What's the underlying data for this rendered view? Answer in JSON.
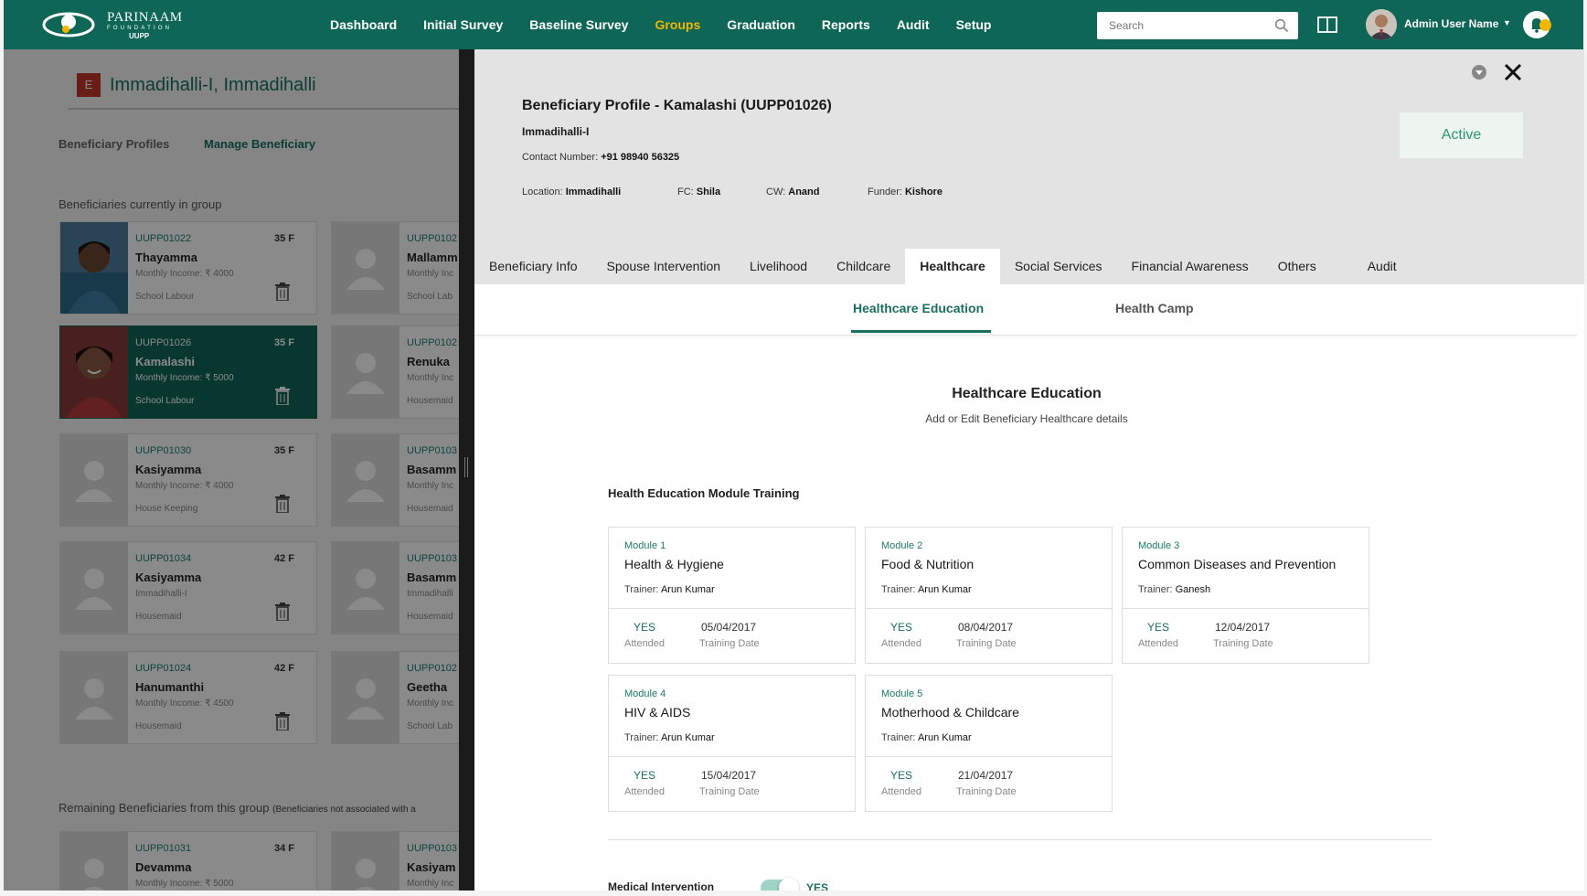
{
  "topbar": {
    "brand_main": "PARINAAM",
    "brand_sub": "FOUNDATION",
    "brand_tag": "UUPP",
    "nav": [
      "Dashboard",
      "Initial Survey",
      "Baseline Survey",
      "Groups",
      "Graduation",
      "Reports",
      "Audit",
      "Setup"
    ],
    "active_nav": "Groups",
    "search_placeholder": "Search",
    "user_name": "Admin User Name",
    "accent_color": "#0d6656",
    "highlight_color": "#f2b705"
  },
  "group": {
    "badge": "E",
    "title": "Immadihalli-I, Immadihalli",
    "tabs": [
      "Beneficiary Profiles",
      "Manage Beneficiary"
    ],
    "current_label": "Beneficiaries currently in group",
    "remaining_label": "Remaining Beneficiaries from this group",
    "remaining_note": "(Beneficiaries not associated with a",
    "current": [
      {
        "id": "UUPP01022",
        "age": "35 F",
        "name": "Thayamma",
        "income": "Monthly Income: ₹ 4000",
        "occupation": "School Labour"
      },
      {
        "id": "UUPP0102",
        "age": "",
        "name": "Mallamm",
        "income": "Monthly Inc",
        "occupation": "School Lab"
      },
      {
        "id": "UUPP01026",
        "age": "35 F",
        "name": "Kamalashi",
        "income": "Monthly Income: ₹ 5000",
        "occupation": "School Labour"
      },
      {
        "id": "UUPP0102",
        "age": "",
        "name": "Renuka",
        "income": "Monthly Inc",
        "occupation": "Housemaid"
      },
      {
        "id": "UUPP01030",
        "age": "35 F",
        "name": "Kasiyamma",
        "income": "Monthly Income: ₹ 4000",
        "occupation": "House Keeping"
      },
      {
        "id": "UUPP0103",
        "age": "",
        "name": "Basamm",
        "income": "Monthly Inc",
        "occupation": "Housemaid"
      },
      {
        "id": "UUPP01034",
        "age": "42 F",
        "name": "Kasiyamma",
        "income": "Immadihalli-I",
        "occupation": "Housemaid"
      },
      {
        "id": "UUPP0103",
        "age": "",
        "name": "Basamm",
        "income": "Immadihalli",
        "occupation": "Housemaid"
      },
      {
        "id": "UUPP01024",
        "age": "42 F",
        "name": "Hanumanthi",
        "income": "Monthly Income: ₹ 4500",
        "occupation": "Housemaid"
      },
      {
        "id": "UUPP0102",
        "age": "",
        "name": "Geetha",
        "income": "Monthly Inc",
        "occupation": "School Lab"
      }
    ],
    "remaining": [
      {
        "id": "UUPP01031",
        "age": "34 F",
        "name": "Devamma",
        "income": "Monthly Income: ₹ 5000",
        "occupation": ""
      },
      {
        "id": "UUPP0103",
        "age": "",
        "name": "Kasiyam",
        "income": "Monthly Inc",
        "occupation": ""
      }
    ]
  },
  "profile": {
    "title": "Beneficiary Profile - Kamalashi (UUPP01026)",
    "group": "Immadihalli-I",
    "contact_label": "Contact Number:",
    "contact": "+91 98940 56325",
    "location_label": "Location:",
    "location": "Immadihalli",
    "fc_label": "FC:",
    "fc": "Shila",
    "cw_label": "CW:",
    "cw": "Anand",
    "funder_label": "Funder:",
    "funder": "Kishore",
    "status": "Active",
    "tabs": [
      "Beneficiary Info",
      "Spouse Intervention",
      "Livelihood",
      "Childcare",
      "Healthcare",
      "Social Services",
      "Financial Awareness",
      "Others",
      "Audit"
    ],
    "active_tab": "Healthcare",
    "subtabs": [
      "Healthcare Education",
      "Health Camp"
    ],
    "active_subtab": "Healthcare Education"
  },
  "healthcare": {
    "title": "Healthcare Education",
    "description": "Add or Edit Beneficiary Healthcare details",
    "modules_heading": "Health Education Module Training",
    "trainer_label": "Trainer:",
    "attended_label": "Attended",
    "date_label": "Training Date",
    "modules": [
      {
        "num": "Module 1",
        "name": "Health & Hygiene",
        "trainer": "Arun Kumar",
        "attended": "YES",
        "date": "05/04/2017"
      },
      {
        "num": "Module 2",
        "name": "Food & Nutrition",
        "trainer": "Arun Kumar",
        "attended": "YES",
        "date": "08/04/2017"
      },
      {
        "num": "Module 3",
        "name": "Common Diseases and Prevention",
        "trainer": "Ganesh",
        "attended": "YES",
        "date": "12/04/2017"
      },
      {
        "num": "Module 4",
        "name": "HIV & AIDS",
        "trainer": "Arun Kumar",
        "attended": "YES",
        "date": "15/04/2017"
      },
      {
        "num": "Module 5",
        "name": "Motherhood & Childcare",
        "trainer": "Arun Kumar",
        "attended": "YES",
        "date": "21/04/2017"
      }
    ],
    "medical_label": "Medical Intervention",
    "medical_value": "YES"
  }
}
